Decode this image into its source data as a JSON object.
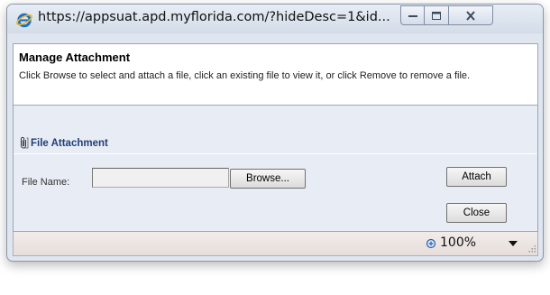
{
  "window": {
    "title": "https://appsuat.apd.myflorida.com/?hideDesc=1&id...",
    "buttons": {
      "minimize_icon": "minimize-icon",
      "maximize_icon": "maximize-icon",
      "close_icon": "close-icon"
    }
  },
  "dialog": {
    "title": "Manage Attachment",
    "description": "Click Browse to select and attach a file, click an existing file to view it, or click Remove to remove a file."
  },
  "section": {
    "title": "File Attachment",
    "icon": "paperclip-icon"
  },
  "form": {
    "file_label": "File Name:",
    "file_value": "",
    "browse_label": "Browse...",
    "attach_label": "Attach",
    "close_label": "Close"
  },
  "statusbar": {
    "zoom": "100%",
    "zoom_icon": "zoom-icon"
  },
  "colors": {
    "section_title": "#1f3f79",
    "frame": "#dfe6ef",
    "content_bg": "#e8ecf4"
  }
}
